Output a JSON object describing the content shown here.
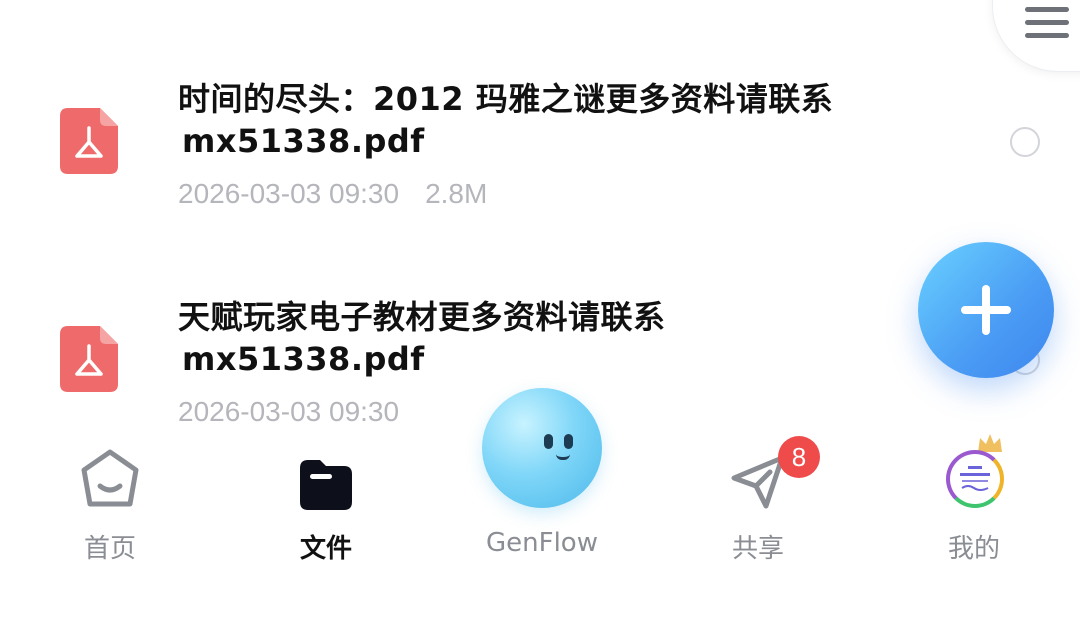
{
  "files": [
    {
      "name_line1": "时间的尽头：2012 玛雅之谜更多资料请联系",
      "name_line2": "mx51338.pdf",
      "date": "2026-03-03 09:30",
      "size": "2.8M",
      "icon": "pdf-icon"
    },
    {
      "name_line1": "天赋玩家电子教材更多资料请联系",
      "name_line2": "mx51338.pdf",
      "date": "2026-03-03 09:30",
      "size": "",
      "icon": "pdf-icon"
    }
  ],
  "nav": {
    "home": "首页",
    "files": "文件",
    "genflow": "GenFlow",
    "share": "共享",
    "mine": "我的",
    "share_badge": "8"
  },
  "colors": {
    "accent_fab": "#4a9cf4",
    "pdf_red": "#ef6b6b",
    "badge_red": "#ef4b4b"
  },
  "icons": {
    "menu": "menu-icon",
    "fab": "plus-icon",
    "home": "home-icon",
    "files": "folder-icon",
    "share": "send-icon"
  }
}
